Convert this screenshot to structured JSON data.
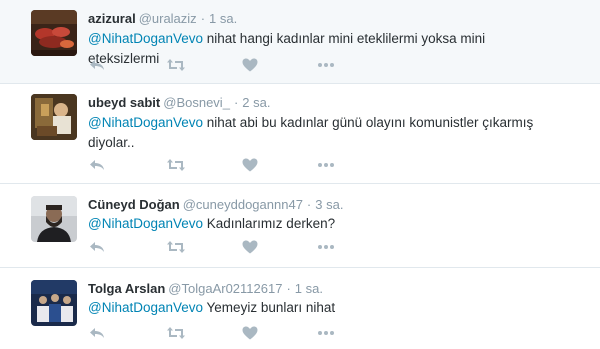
{
  "tweets": [
    {
      "fullname": "azizural",
      "username": "@uralaziz",
      "separator": "·",
      "time": "1 sa.",
      "mention": "@NihatDoganVevo",
      "text": " nihat hangi kadınlar mini eteklilermi yoksa mini eteksizlermi"
    },
    {
      "fullname": "ubeyd sabit",
      "username": "@Bosnevi_",
      "separator": "·",
      "time": "2 sa.",
      "mention": "@NihatDoganVevo",
      "text": " nihat abi bu kadınlar günü olayını komunistler çıkarmış diyolar.."
    },
    {
      "fullname": "Cüneyd Doğan",
      "username": "@cuneyddogannn47",
      "separator": "·",
      "time": "3 sa.",
      "mention": "@NihatDoganVevo",
      "text": " Kadınlarımız derken?"
    },
    {
      "fullname": "Tolga Arslan",
      "username": "@TolgaAr02112617",
      "separator": "·",
      "time": "1 sa.",
      "mention": "@NihatDoganVevo",
      "text": " Yemeyiz bunları nihat"
    }
  ],
  "icons": {
    "reply": "reply-icon",
    "retweet": "retweet-icon",
    "like": "heart-icon",
    "more": "more-dots-icon"
  },
  "colors": {
    "mention": "#0084b4",
    "icon": "#aab8c2",
    "muted": "#8899a6",
    "text": "#292f33"
  }
}
